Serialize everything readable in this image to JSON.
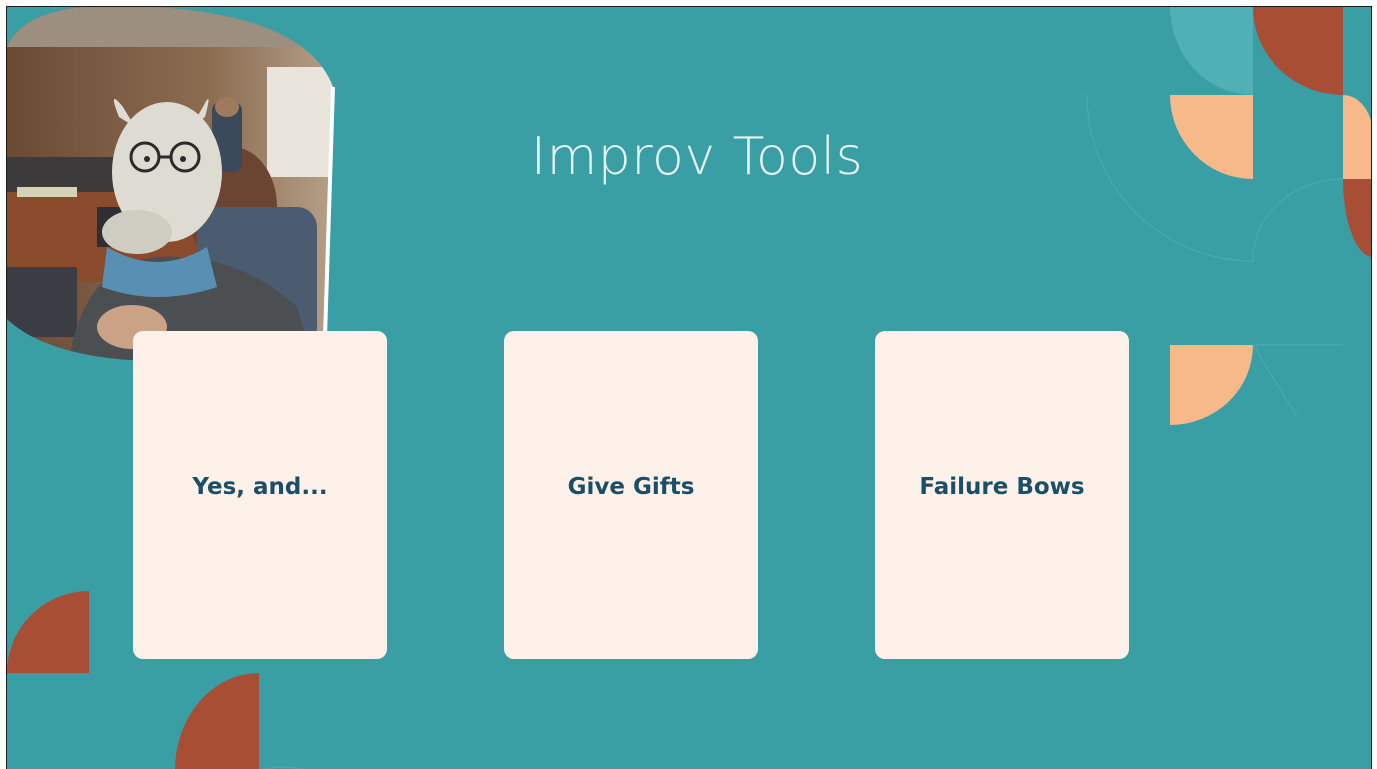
{
  "slide": {
    "title": "Improv Tools",
    "cards": [
      {
        "label": "Yes, and..."
      },
      {
        "label": "Give Gifts"
      },
      {
        "label": "Failure Bows"
      }
    ],
    "photo": {
      "icon": "photo-person-in-llama-mask"
    }
  },
  "colors": {
    "background": "#3a9ea5",
    "card": "#fdf1e9",
    "card_text": "#1b4f67",
    "title_text": "#e6f4f5",
    "rust": "#a84e35",
    "peach": "#f8b98a",
    "light_teal": "#4fb1b6"
  }
}
